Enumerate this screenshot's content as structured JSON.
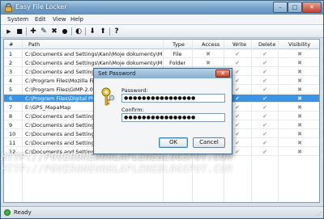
{
  "window": {
    "title": "Easy File Locker",
    "buttons": {
      "minimize": "–",
      "maximize": "□",
      "close": "✕"
    }
  },
  "menu": [
    "System",
    "Edit",
    "View",
    "Help"
  ],
  "toolbar": {
    "icons": [
      "play-icon",
      "stop-icon",
      "add-icon",
      "edit-icon",
      "remove-icon",
      "lock-icon",
      "toggle-icon",
      "move-down-icon",
      "move-up-icon",
      "help-icon"
    ],
    "glyphs": [
      "▶",
      "■",
      "✚",
      "✎",
      "✖",
      "●",
      "◐",
      "⬇",
      "⬆",
      "?"
    ]
  },
  "grid": {
    "columns": [
      "#",
      "Path",
      "Type",
      "Access",
      "Write",
      "Delete",
      "Visibility"
    ],
    "rows": [
      {
        "num": "1",
        "path": "C:\\Documents and Settings\\Kani\\Moje dokumenty\\M...",
        "type": "File"
      },
      {
        "num": "2",
        "path": "C:\\Documents and Settings\\Kani\\Moje dokumenty\\M...",
        "type": "Folder"
      },
      {
        "num": "3",
        "path": "C:\\Documents and Settings\\Kani\\Moje dokumenty\\M...",
        "type": ""
      },
      {
        "num": "4",
        "path": "C:\\Program Files\\Mozilla Fire",
        "type": ""
      },
      {
        "num": "5",
        "path": "C:\\Program Files\\GIMP-2.0",
        "type": ""
      },
      {
        "num": "6",
        "path": "C:\\Program Files\\Digital Pho",
        "type": "",
        "selected": true
      },
      {
        "num": "7",
        "path": "E:\\GPS_MapaMap",
        "type": ""
      },
      {
        "num": "8",
        "path": "C:\\Documents and Settings",
        "type": ""
      },
      {
        "num": "9",
        "path": "C:\\Documents and Settings",
        "type": ""
      },
      {
        "num": "10",
        "path": "C:\\Documents and Settings",
        "type": ""
      },
      {
        "num": "11",
        "path": "C:\\Documents and Settings",
        "type": ""
      },
      {
        "num": "12",
        "path": "C:\\Documents and Settings",
        "type": ""
      }
    ]
  },
  "watermark": {
    "line1": "HTTP://POVERONEWOHLAPLENEBLOGSPOT.COM",
    "line2": "HTTP://POVERONEWOHLAPLENEBLOGSPOT.COM"
  },
  "status": {
    "text": "Ready"
  },
  "dialog": {
    "title": "Set Password",
    "close": "✕",
    "password_label": "Password:",
    "password_value": "●●●●●●●●●●●●●●●●",
    "confirm_label": "Confirm:",
    "confirm_value": "●●●●●●●●●●●●●●●●",
    "ok_label": "OK",
    "cancel_label": "Cancel"
  }
}
